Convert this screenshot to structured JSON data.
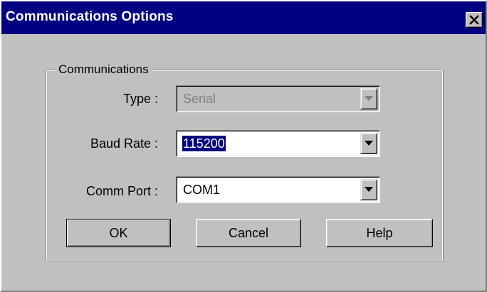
{
  "window": {
    "title": "Communications Options"
  },
  "group": {
    "label": "Communications"
  },
  "fields": {
    "type": {
      "label": "Type :",
      "value": "Serial",
      "disabled": true
    },
    "baud_rate": {
      "label": "Baud Rate :",
      "value": "115200",
      "selected": true
    },
    "comm_port": {
      "label": "Comm Port :",
      "value": "COM1"
    }
  },
  "buttons": {
    "ok": "OK",
    "cancel": "Cancel",
    "help": "Help"
  },
  "colors": {
    "titlebar": "#000080",
    "face": "#c0c0c0",
    "selection": "#000080",
    "disabled_text": "#808080"
  },
  "icons": {
    "close": "close-icon",
    "dropdown": "chevron-down-icon"
  }
}
